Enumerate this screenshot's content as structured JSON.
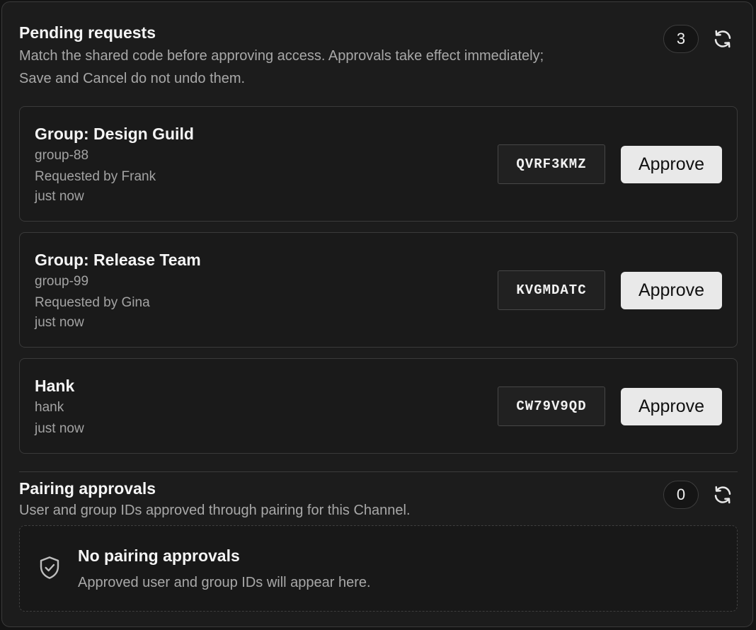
{
  "pending": {
    "title": "Pending requests",
    "description": "Match the shared code before approving access. Approvals take effect immediately; Save and Cancel do not undo them.",
    "count": "3",
    "requests": [
      {
        "name": "Group: Design Guild",
        "id": "group-88",
        "requested_by": "Requested by Frank",
        "time": "just now",
        "code": "QVRF3KMZ",
        "approve_label": "Approve"
      },
      {
        "name": "Group: Release Team",
        "id": "group-99",
        "requested_by": "Requested by Gina",
        "time": "just now",
        "code": "KVGMDATC",
        "approve_label": "Approve"
      },
      {
        "name": "Hank",
        "id": "hank",
        "time": "just now",
        "code": "CW79V9QD",
        "approve_label": "Approve"
      }
    ]
  },
  "pairing": {
    "title": "Pairing approvals",
    "description": "User and group IDs approved through pairing for this Channel.",
    "count": "0",
    "empty_title": "No pairing approvals",
    "empty_description": "Approved user and group IDs will appear here."
  },
  "icons": {
    "refresh": "refresh-icon",
    "shield": "shield-check-icon"
  }
}
